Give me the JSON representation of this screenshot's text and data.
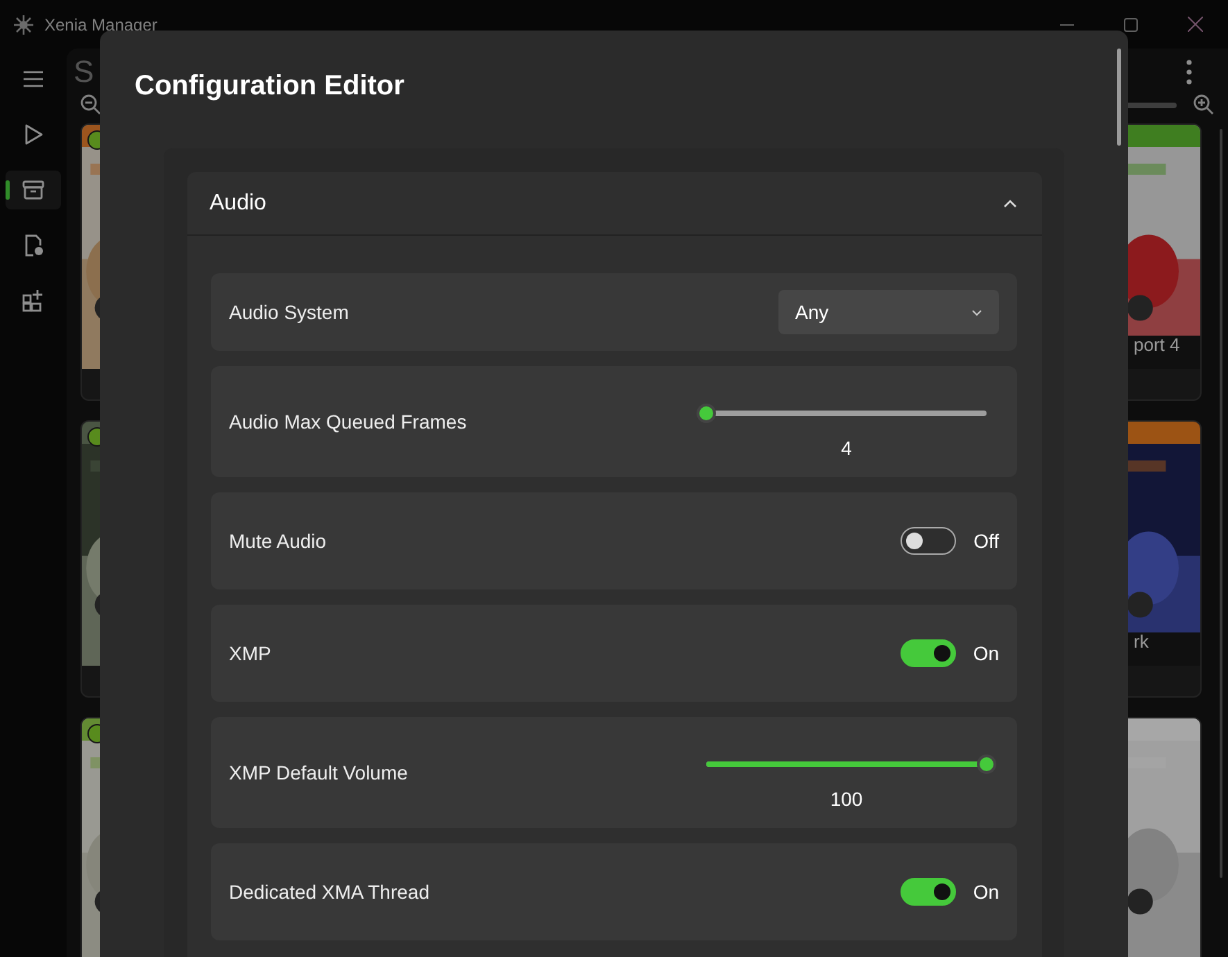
{
  "window": {
    "title": "Xenia Manager"
  },
  "nav": [
    {
      "kind": "menu",
      "selected": false
    },
    {
      "kind": "play",
      "selected": false
    },
    {
      "kind": "library",
      "selected": true
    },
    {
      "kind": "file-settings",
      "selected": false
    },
    {
      "kind": "add-grid",
      "selected": false
    }
  ],
  "page": {
    "title": "S"
  },
  "games": {
    "left": [
      {
        "kind": "picture"
      },
      {
        "kind": "picture"
      },
      {
        "kind": "picture"
      }
    ],
    "right": [
      {
        "kind": "picture",
        "caption": "port 4"
      },
      {
        "kind": "picture",
        "caption": "rk"
      },
      {
        "kind": "picture"
      }
    ]
  },
  "dialog": {
    "title": "Configuration Editor",
    "sections": [
      {
        "title": "Audio",
        "expanded": true,
        "settings": [
          {
            "kind": "dropdown",
            "label": "Audio System",
            "value": "Any"
          },
          {
            "kind": "slider",
            "label": "Audio Max Queued Frames",
            "level": 0,
            "reading": "4"
          },
          {
            "kind": "toggle",
            "label": "Mute Audio",
            "on": false,
            "state_text": "Off"
          },
          {
            "kind": "toggle",
            "label": "XMP",
            "on": true,
            "state_text": "On"
          },
          {
            "kind": "slider",
            "label": "XMP Default Volume",
            "level": 1,
            "reading": "100"
          },
          {
            "kind": "toggle",
            "label": "Dedicated XMA Thread",
            "on": true,
            "state_text": "On"
          }
        ]
      }
    ]
  }
}
